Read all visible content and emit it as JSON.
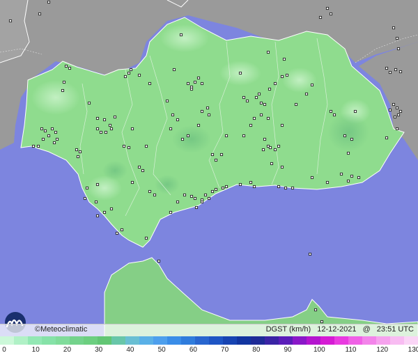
{
  "credit": "©Meteoclimatic",
  "product": "DGST (km/h)",
  "date": "12-12-2021",
  "at": "@",
  "time": "23:51 UTC",
  "icons": {
    "logo": "meteoclimatic-logo-icon",
    "station": "station-marker-icon"
  },
  "colors": {
    "sea": "#7d85df",
    "land_outside": "#9a9a9a",
    "land_region": "#8fdc8e",
    "border": "#ffffff",
    "marker": "#222222"
  },
  "scale": {
    "ticks": [
      "0",
      "10",
      "20",
      "30",
      "40",
      "50",
      "60",
      "70",
      "80",
      "90",
      "100",
      "110",
      "120",
      "130"
    ],
    "colors": [
      "#ccf8d9",
      "#b0f1c6",
      "#93e8b4",
      "#86e2a8",
      "#80dc9b",
      "#74d38c",
      "#6ccf80",
      "#62c674",
      "#68c6a9",
      "#69bfd3",
      "#5ab0e7",
      "#4d9fed",
      "#3a8de8",
      "#2f7cdc",
      "#2866cf",
      "#1e55c4",
      "#1744b2",
      "#1235a0",
      "#1f2b97",
      "#3a24a5",
      "#5a1db9",
      "#8a18c8",
      "#b415cf",
      "#d51bd4",
      "#e93be0",
      "#f061e6",
      "#f384ea",
      "#f6a2ee",
      "#f8bcf2",
      "#fad5f6"
    ]
  },
  "stations_count_label": ""
}
